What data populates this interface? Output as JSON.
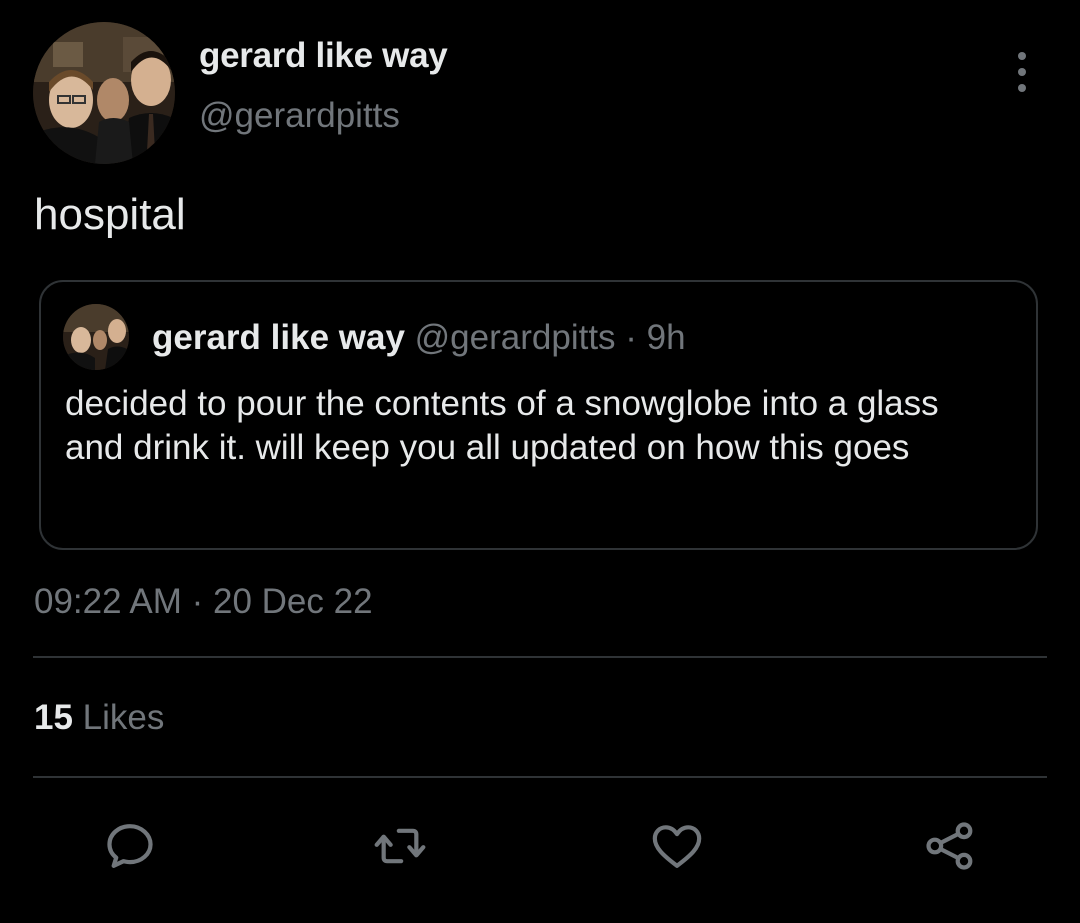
{
  "tweet": {
    "display_name": "gerard like way",
    "handle": "@gerardpitts",
    "text": "hospital",
    "timestamp": "09:22 AM · 20 Dec 22",
    "likes_count": "15",
    "likes_label": "Likes"
  },
  "quoted": {
    "display_name": "gerard like way",
    "meta": "@gerardpitts · 9h",
    "text": "decided to pour the contents of a snowglobe into a glass and drink it. will keep you all updated on how this goes"
  },
  "icons": {
    "more": "more-vertical-icon",
    "reply": "reply-icon",
    "retweet": "retweet-icon",
    "like": "like-icon",
    "share": "share-icon"
  },
  "colors": {
    "background": "#000000",
    "primary_text": "#e7e9ea",
    "secondary_text": "#71767b",
    "border": "#2f3336"
  }
}
